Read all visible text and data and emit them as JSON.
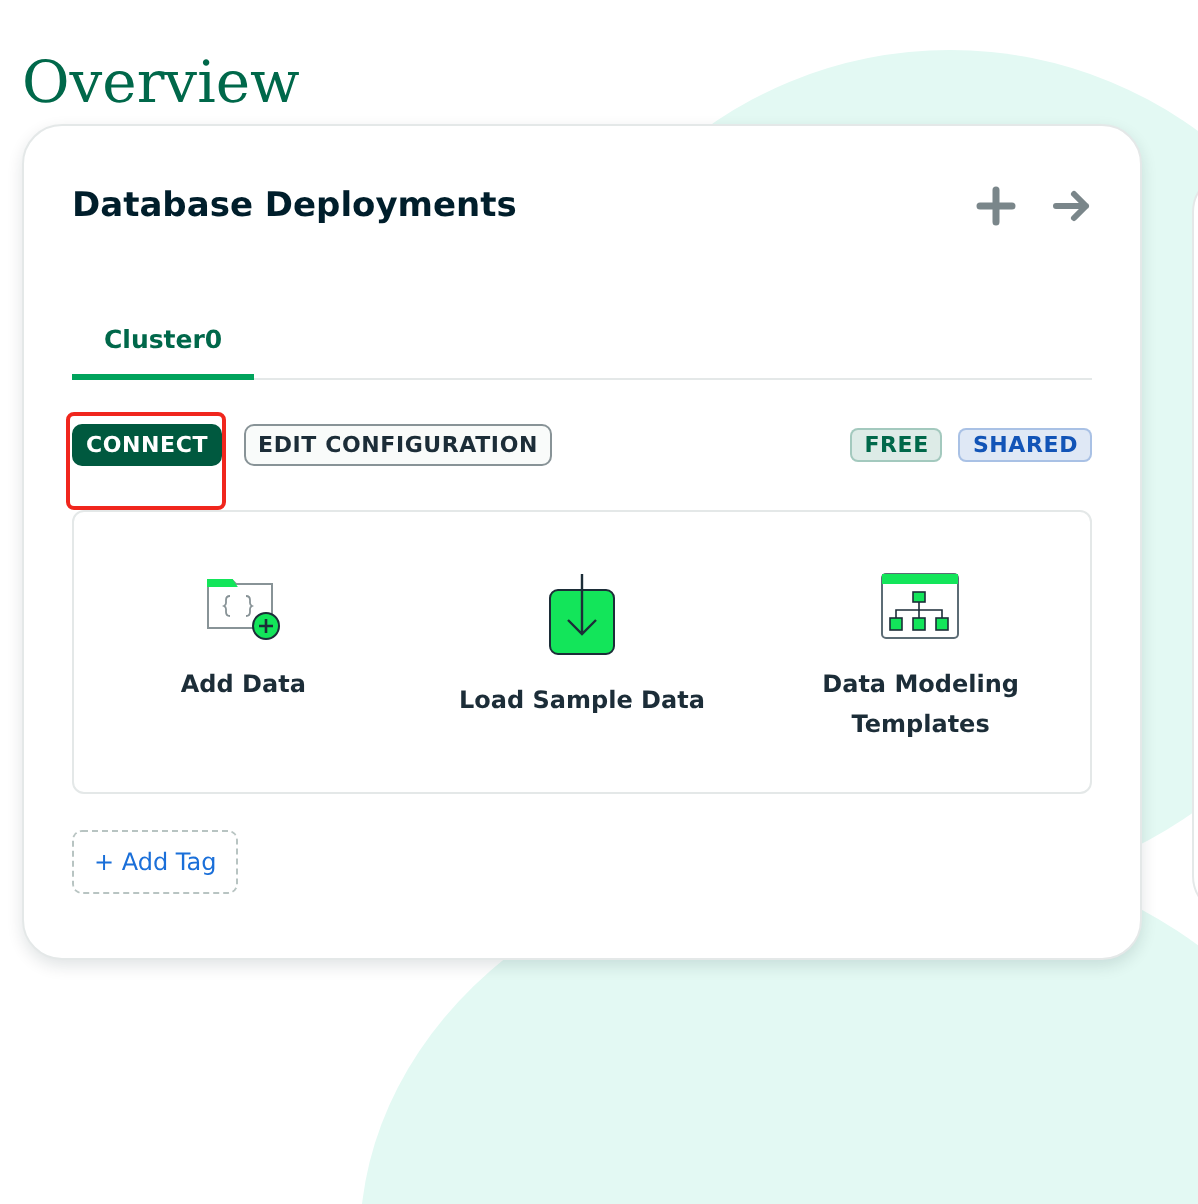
{
  "page_title": "Overview",
  "card": {
    "title": "Database Deployments",
    "tabs": [
      {
        "label": "Cluster0",
        "selected": true
      }
    ],
    "actions": [
      {
        "label": "CONNECT",
        "kind": "primary",
        "highlighted": true
      },
      {
        "label": "EDIT CONFIGURATION",
        "kind": "outline",
        "highlighted": false
      }
    ],
    "tags": [
      {
        "label": "FREE",
        "color": "#00684a"
      },
      {
        "label": "SHARED",
        "color": "#1254b7"
      }
    ],
    "options": [
      {
        "label": "Add Data",
        "kind": "add-data"
      },
      {
        "label": "Load Sample Data",
        "kind": "load-sample"
      },
      {
        "label": "Data Modeling Templates",
        "kind": "templates"
      }
    ],
    "add_tag": "+ Add Tag"
  }
}
